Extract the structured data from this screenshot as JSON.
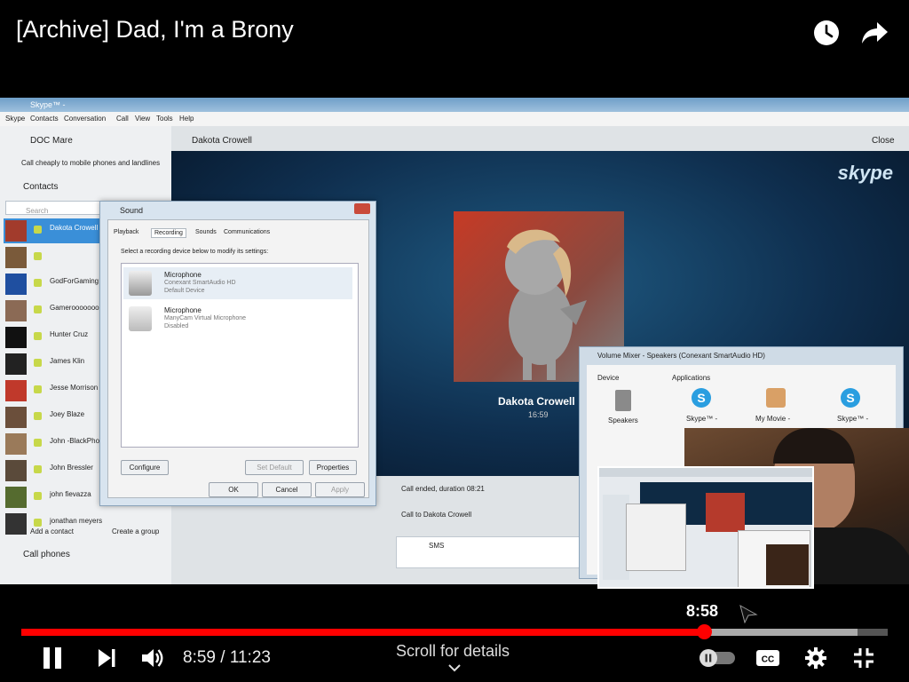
{
  "video": {
    "title": "[Archive] Dad, I'm a Brony",
    "watch_later_icon": "clock-icon",
    "share_icon": "share-arrow-icon"
  },
  "skype": {
    "window_title": "Skype™ - ",
    "menu": [
      "Skype",
      "Contacts",
      "Conversation",
      "Call",
      "View",
      "Tools",
      "Help"
    ],
    "profile_name": "DOC Mare",
    "call_cheaply": "Call cheaply to mobile phones and landlines",
    "contacts_header": "Contacts",
    "search_placeholder": "Search",
    "contacts": [
      {
        "name": "Dakota Crowell",
        "color": "#a23b2c"
      },
      {
        "name": "",
        "color": "#7a5a3a"
      },
      {
        "name": "GodForGaming",
        "color": "#1f4fa0"
      },
      {
        "name": "Gamerooooooooo",
        "color": "#8b6a55"
      },
      {
        "name": "Hunter Cruz",
        "color": "#111111"
      },
      {
        "name": "James Klin",
        "color": "#222222"
      },
      {
        "name": "Jesse Morrison",
        "color": "#c0392b"
      },
      {
        "name": "Joey Blaze",
        "color": "#6b4f3b"
      },
      {
        "name": "John -BlackPhoe",
        "color": "#9a7a5a"
      },
      {
        "name": "John Bressler",
        "color": "#5a4a3a"
      },
      {
        "name": "john fievazza",
        "color": "#556b2f"
      },
      {
        "name": "jonathan meyers",
        "color": "#333333"
      }
    ],
    "add_contact": "Add a contact",
    "create_group": "Create a group",
    "call_phones": "Call phones",
    "conversation_name": "Dakota Crowell",
    "close": "Close",
    "skype_logo": "skype",
    "caller_name": "Dakota Crowell",
    "call_time": "16:59",
    "call_ended": "Call ended, duration 08:21",
    "call_to": "Call to Dakota Crowell",
    "sms_label": "SMS"
  },
  "sound_dialog": {
    "title": "Sound",
    "tabs": [
      "Playback",
      "Recording",
      "Sounds",
      "Communications"
    ],
    "instruction": "Select a recording device below to modify its settings:",
    "devices": [
      {
        "name": "Microphone",
        "detail": "Conexant SmartAudio HD",
        "status": "Default Device"
      },
      {
        "name": "Microphone",
        "detail": "ManyCam Virtual Microphone",
        "status": "Disabled"
      }
    ],
    "configure": "Configure",
    "set_default": "Set Default",
    "properties": "Properties",
    "ok": "OK",
    "cancel": "Cancel",
    "apply": "Apply"
  },
  "mixer": {
    "title": "Volume Mixer - Speakers (Conexant SmartAudio HD)",
    "device_label": "Device",
    "applications_label": "Applications",
    "speakers": "Speakers",
    "apps": [
      "Skype™ -",
      "My Movie -",
      "Skype™ -"
    ]
  },
  "player": {
    "preview_time": "8:58",
    "current_time": "8:59",
    "duration": "11:23",
    "time_display": "8:59 / 11:23",
    "progress_fraction": 0.788,
    "buffered_fraction": 0.965,
    "scroll_hint": "Scroll for details",
    "autoplay_on": false,
    "colors": {
      "progress": "#ff0000",
      "background": "#000000"
    }
  }
}
